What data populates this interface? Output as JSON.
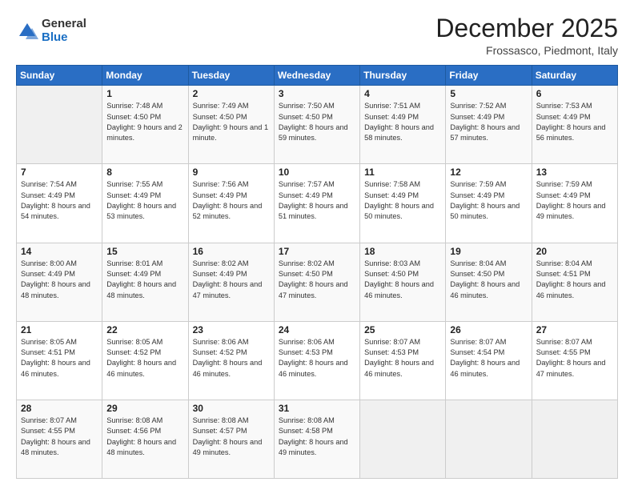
{
  "header": {
    "logo": {
      "general": "General",
      "blue": "Blue"
    },
    "title": "December 2025",
    "location": "Frossasco, Piedmont, Italy"
  },
  "days_of_week": [
    "Sunday",
    "Monday",
    "Tuesday",
    "Wednesday",
    "Thursday",
    "Friday",
    "Saturday"
  ],
  "weeks": [
    [
      {
        "day": "",
        "sunrise": "",
        "sunset": "",
        "daylight": ""
      },
      {
        "day": "1",
        "sunrise": "Sunrise: 7:48 AM",
        "sunset": "Sunset: 4:50 PM",
        "daylight": "Daylight: 9 hours and 2 minutes."
      },
      {
        "day": "2",
        "sunrise": "Sunrise: 7:49 AM",
        "sunset": "Sunset: 4:50 PM",
        "daylight": "Daylight: 9 hours and 1 minute."
      },
      {
        "day": "3",
        "sunrise": "Sunrise: 7:50 AM",
        "sunset": "Sunset: 4:50 PM",
        "daylight": "Daylight: 8 hours and 59 minutes."
      },
      {
        "day": "4",
        "sunrise": "Sunrise: 7:51 AM",
        "sunset": "Sunset: 4:49 PM",
        "daylight": "Daylight: 8 hours and 58 minutes."
      },
      {
        "day": "5",
        "sunrise": "Sunrise: 7:52 AM",
        "sunset": "Sunset: 4:49 PM",
        "daylight": "Daylight: 8 hours and 57 minutes."
      },
      {
        "day": "6",
        "sunrise": "Sunrise: 7:53 AM",
        "sunset": "Sunset: 4:49 PM",
        "daylight": "Daylight: 8 hours and 56 minutes."
      }
    ],
    [
      {
        "day": "7",
        "sunrise": "Sunrise: 7:54 AM",
        "sunset": "Sunset: 4:49 PM",
        "daylight": "Daylight: 8 hours and 54 minutes."
      },
      {
        "day": "8",
        "sunrise": "Sunrise: 7:55 AM",
        "sunset": "Sunset: 4:49 PM",
        "daylight": "Daylight: 8 hours and 53 minutes."
      },
      {
        "day": "9",
        "sunrise": "Sunrise: 7:56 AM",
        "sunset": "Sunset: 4:49 PM",
        "daylight": "Daylight: 8 hours and 52 minutes."
      },
      {
        "day": "10",
        "sunrise": "Sunrise: 7:57 AM",
        "sunset": "Sunset: 4:49 PM",
        "daylight": "Daylight: 8 hours and 51 minutes."
      },
      {
        "day": "11",
        "sunrise": "Sunrise: 7:58 AM",
        "sunset": "Sunset: 4:49 PM",
        "daylight": "Daylight: 8 hours and 50 minutes."
      },
      {
        "day": "12",
        "sunrise": "Sunrise: 7:59 AM",
        "sunset": "Sunset: 4:49 PM",
        "daylight": "Daylight: 8 hours and 50 minutes."
      },
      {
        "day": "13",
        "sunrise": "Sunrise: 7:59 AM",
        "sunset": "Sunset: 4:49 PM",
        "daylight": "Daylight: 8 hours and 49 minutes."
      }
    ],
    [
      {
        "day": "14",
        "sunrise": "Sunrise: 8:00 AM",
        "sunset": "Sunset: 4:49 PM",
        "daylight": "Daylight: 8 hours and 48 minutes."
      },
      {
        "day": "15",
        "sunrise": "Sunrise: 8:01 AM",
        "sunset": "Sunset: 4:49 PM",
        "daylight": "Daylight: 8 hours and 48 minutes."
      },
      {
        "day": "16",
        "sunrise": "Sunrise: 8:02 AM",
        "sunset": "Sunset: 4:49 PM",
        "daylight": "Daylight: 8 hours and 47 minutes."
      },
      {
        "day": "17",
        "sunrise": "Sunrise: 8:02 AM",
        "sunset": "Sunset: 4:50 PM",
        "daylight": "Daylight: 8 hours and 47 minutes."
      },
      {
        "day": "18",
        "sunrise": "Sunrise: 8:03 AM",
        "sunset": "Sunset: 4:50 PM",
        "daylight": "Daylight: 8 hours and 46 minutes."
      },
      {
        "day": "19",
        "sunrise": "Sunrise: 8:04 AM",
        "sunset": "Sunset: 4:50 PM",
        "daylight": "Daylight: 8 hours and 46 minutes."
      },
      {
        "day": "20",
        "sunrise": "Sunrise: 8:04 AM",
        "sunset": "Sunset: 4:51 PM",
        "daylight": "Daylight: 8 hours and 46 minutes."
      }
    ],
    [
      {
        "day": "21",
        "sunrise": "Sunrise: 8:05 AM",
        "sunset": "Sunset: 4:51 PM",
        "daylight": "Daylight: 8 hours and 46 minutes."
      },
      {
        "day": "22",
        "sunrise": "Sunrise: 8:05 AM",
        "sunset": "Sunset: 4:52 PM",
        "daylight": "Daylight: 8 hours and 46 minutes."
      },
      {
        "day": "23",
        "sunrise": "Sunrise: 8:06 AM",
        "sunset": "Sunset: 4:52 PM",
        "daylight": "Daylight: 8 hours and 46 minutes."
      },
      {
        "day": "24",
        "sunrise": "Sunrise: 8:06 AM",
        "sunset": "Sunset: 4:53 PM",
        "daylight": "Daylight: 8 hours and 46 minutes."
      },
      {
        "day": "25",
        "sunrise": "Sunrise: 8:07 AM",
        "sunset": "Sunset: 4:53 PM",
        "daylight": "Daylight: 8 hours and 46 minutes."
      },
      {
        "day": "26",
        "sunrise": "Sunrise: 8:07 AM",
        "sunset": "Sunset: 4:54 PM",
        "daylight": "Daylight: 8 hours and 46 minutes."
      },
      {
        "day": "27",
        "sunrise": "Sunrise: 8:07 AM",
        "sunset": "Sunset: 4:55 PM",
        "daylight": "Daylight: 8 hours and 47 minutes."
      }
    ],
    [
      {
        "day": "28",
        "sunrise": "Sunrise: 8:07 AM",
        "sunset": "Sunset: 4:55 PM",
        "daylight": "Daylight: 8 hours and 48 minutes."
      },
      {
        "day": "29",
        "sunrise": "Sunrise: 8:08 AM",
        "sunset": "Sunset: 4:56 PM",
        "daylight": "Daylight: 8 hours and 48 minutes."
      },
      {
        "day": "30",
        "sunrise": "Sunrise: 8:08 AM",
        "sunset": "Sunset: 4:57 PM",
        "daylight": "Daylight: 8 hours and 49 minutes."
      },
      {
        "day": "31",
        "sunrise": "Sunrise: 8:08 AM",
        "sunset": "Sunset: 4:58 PM",
        "daylight": "Daylight: 8 hours and 49 minutes."
      },
      {
        "day": "",
        "sunrise": "",
        "sunset": "",
        "daylight": ""
      },
      {
        "day": "",
        "sunrise": "",
        "sunset": "",
        "daylight": ""
      },
      {
        "day": "",
        "sunrise": "",
        "sunset": "",
        "daylight": ""
      }
    ]
  ]
}
